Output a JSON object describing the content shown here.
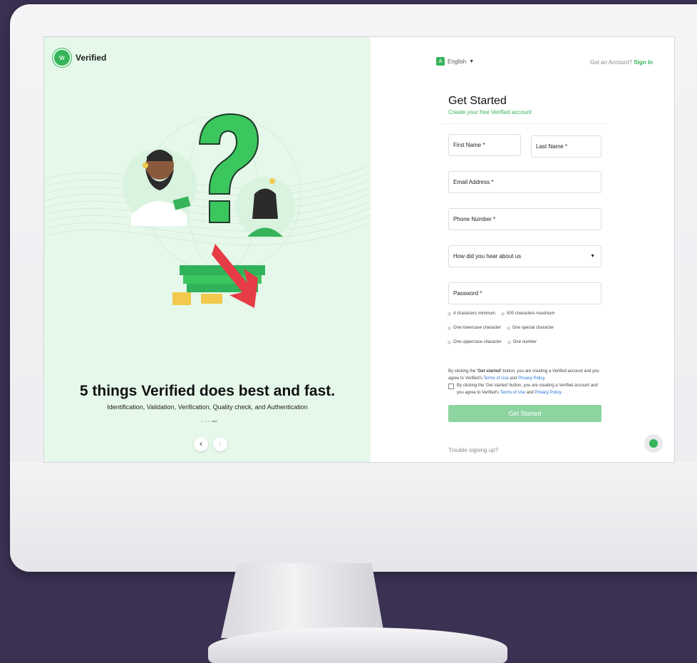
{
  "brand": {
    "name": "Verified",
    "logo_mark": "Vr"
  },
  "hero": {
    "headline": "5 things Verified does best and fast.",
    "subline": "Identification, Validation, Verification, Quality check, and Authentication",
    "prev_icon": "chevron-left-icon",
    "next_icon": "chevron-right-icon",
    "prev_glyph": "‹",
    "next_glyph": "›",
    "carousel_active_index": 3,
    "carousel_count": 4
  },
  "header": {
    "language": "English",
    "account_prompt": "Got an Account?",
    "signin_label": "Sign In"
  },
  "form": {
    "title": "Get Started",
    "subtitle": "Create your free Verified account",
    "first_name": "First Name *",
    "last_name": "Last Name *",
    "email": "Email Address *",
    "phone": "Phone Number *",
    "source": "How did you hear about us",
    "password": "Password *",
    "rules": [
      [
        "4 characters minimum",
        "500 characters maximum"
      ],
      [
        "One lowercase character",
        "One special character"
      ],
      [
        "One uppercase character",
        "One number"
      ]
    ],
    "terms_prefix": "By clicking the ",
    "terms_button_ref": "'Get started'",
    "terms_mid": " button, you are creating a Verified account and you agree to Verified's ",
    "terms_of_use": "Terms of Use",
    "terms_and": " and ",
    "privacy_policy": "Privacy Policy",
    "terms_end": ".",
    "checkbox_text_prefix": "By clicking the 'Get started' button, you are creating a Verified account and you agree to Verified's ",
    "submit_label": "Get Started",
    "trouble_label": "Trouble signing up?"
  },
  "colors": {
    "brand_green": "#35b459",
    "hero_bg": "#e6f8ea",
    "submit_bg": "#8dd4a0",
    "link_blue": "#1e6fd9",
    "backdrop": "#3b3152"
  }
}
